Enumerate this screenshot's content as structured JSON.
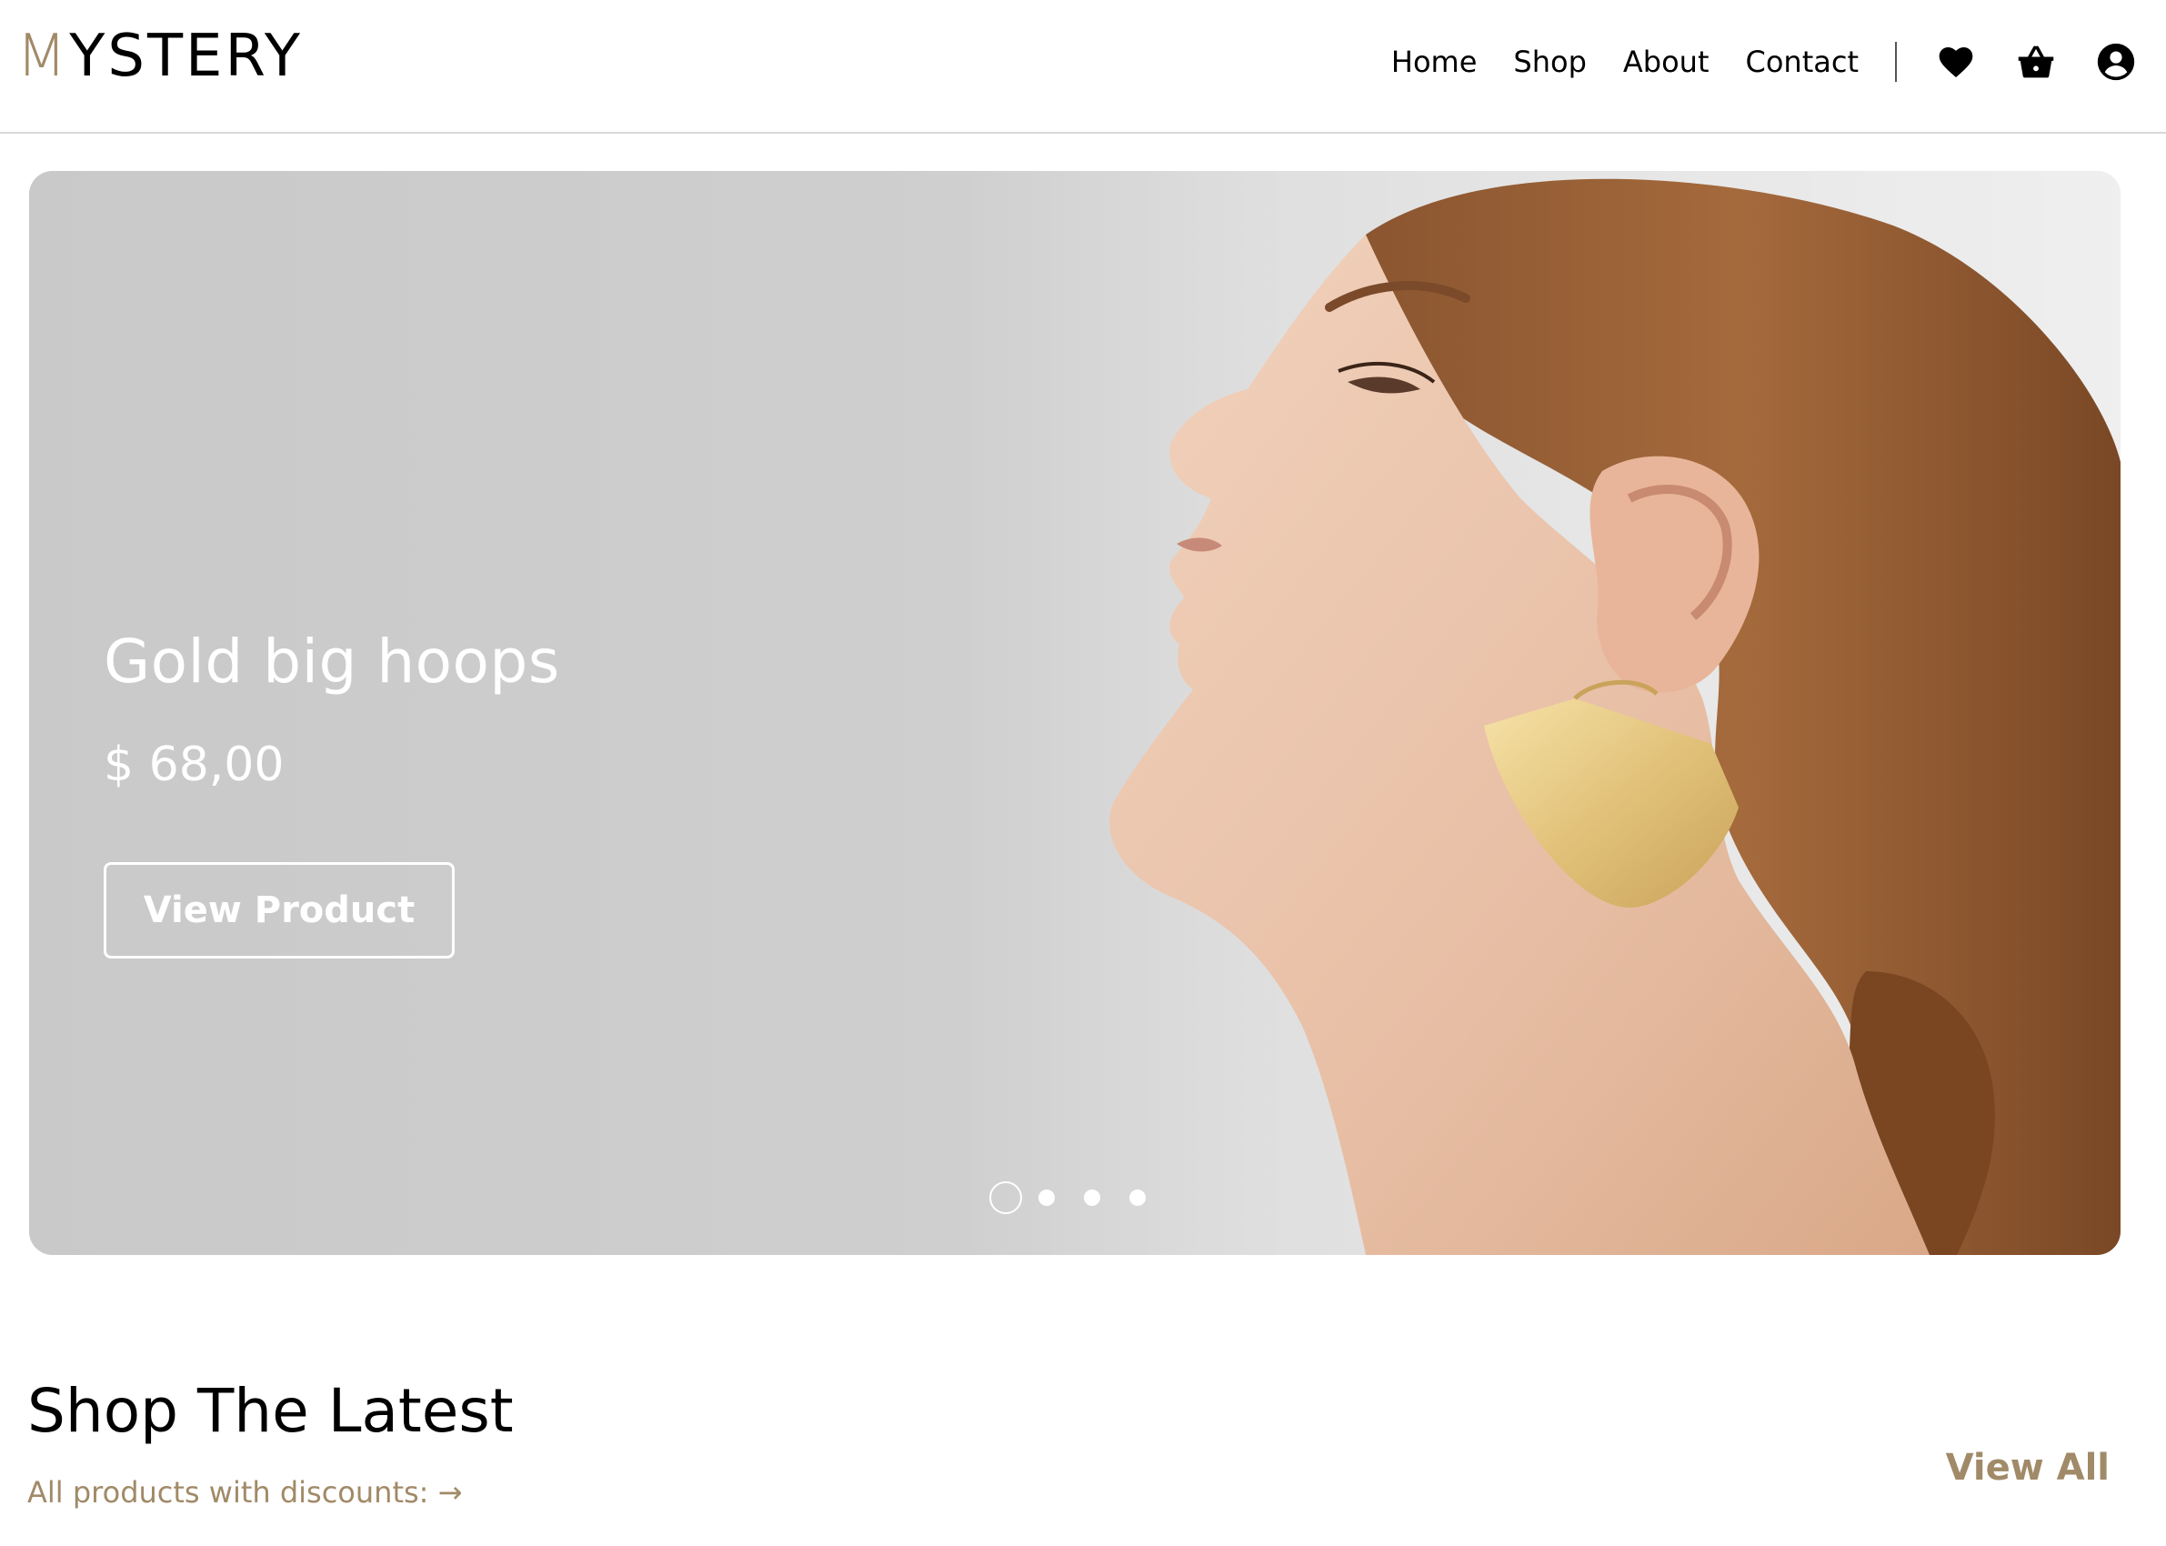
{
  "brand": {
    "logo_first": "M",
    "logo_rest": "YSTERY",
    "accent_color": "#a18a68"
  },
  "nav": {
    "links": [
      "Home",
      "Shop",
      "About",
      "Contact"
    ],
    "icons": [
      "heart-icon",
      "shopping-basket-icon",
      "user-account-icon"
    ]
  },
  "hero": {
    "title": "Gold big hoops",
    "price": "$ 68,00",
    "button_label": "View Product",
    "slides_total": 4,
    "active_slide": 1
  },
  "latest": {
    "title": "Shop The Latest",
    "subtitle": "All products with discounts: →",
    "view_all_label": "View All"
  }
}
